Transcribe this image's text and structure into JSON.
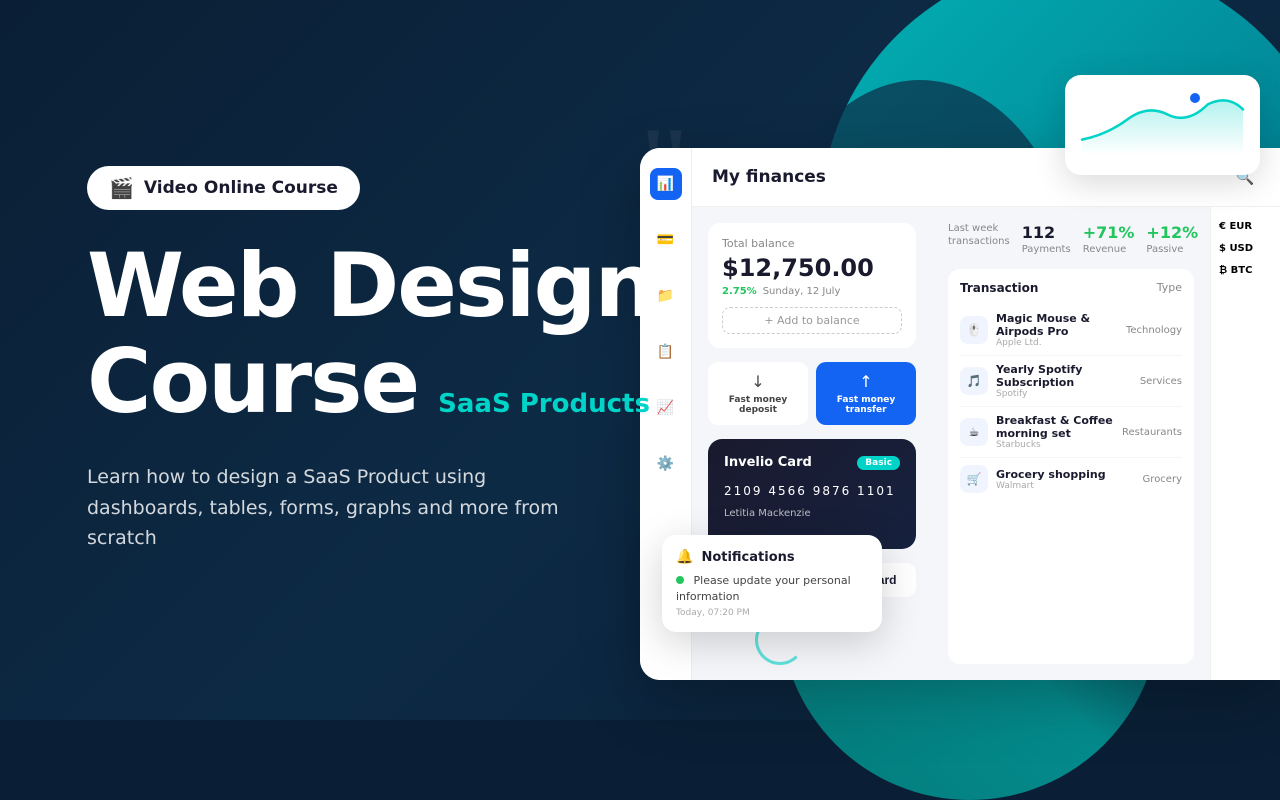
{
  "background": {
    "color_primary": "#0a1f35",
    "color_accent": "#00d4c8"
  },
  "badge": {
    "icon": "🎬",
    "text": "Video Online Course"
  },
  "hero": {
    "title_line1": "Web Design",
    "title_line2": "Course",
    "saas_tag": "SaaS Products",
    "subtitle": "Learn how to design a SaaS Product using dashboards, tables, forms, graphs and more from scratch"
  },
  "dashboard": {
    "title": "My finances",
    "balance": {
      "label": "Total balance",
      "amount": "$12,750.00",
      "change": "2.75%",
      "date": "Sunday, 12 July",
      "add_label": "+ Add to balance"
    },
    "actions": [
      {
        "label": "Fast money deposit",
        "icon": "↓",
        "active": false
      },
      {
        "label": "Fast money transfer",
        "icon": "↑",
        "active": true
      }
    ],
    "stats": [
      {
        "label": "Last week transactions",
        "value": ""
      },
      {
        "label": "Payments",
        "value": "112"
      },
      {
        "label": "Revenue",
        "value": "+71%"
      },
      {
        "label": "Passive",
        "value": "+12%"
      }
    ],
    "card": {
      "name": "Invelio Card",
      "badge": "Basic",
      "number": "2109  4566  9876  1101",
      "holder": "Letitia Mackenzie",
      "upgrade_label": "Upgrade to Platinum Card"
    },
    "transactions": {
      "title": "Transaction",
      "type_label": "Type",
      "items": [
        {
          "name": "Magic Mouse & Airpods Pro",
          "sub": "Apple Ltd.",
          "type": "Technology",
          "icon": "🖱️"
        },
        {
          "name": "Yearly Spotify Subscription",
          "sub": "Spotify",
          "type": "Services",
          "icon": "🎵"
        },
        {
          "name": "Breakfast & Coffee morning set",
          "sub": "Starbucks",
          "type": "Restaurants",
          "icon": "☕"
        },
        {
          "name": "Grocery shopping",
          "sub": "Walmart",
          "type": "Grocery",
          "icon": "🛒"
        }
      ]
    },
    "currencies": [
      {
        "flag": "€",
        "name": "EUR"
      },
      {
        "flag": "$",
        "name": "USD"
      },
      {
        "flag": "₿",
        "name": "BTC"
      }
    ]
  },
  "notification": {
    "title": "Notifications",
    "message": "Please update your personal information",
    "time": "Today, 07:20 PM"
  },
  "sidebar_icons": [
    "📊",
    "💳",
    "📁",
    "📋",
    "📈",
    "⚙️"
  ]
}
